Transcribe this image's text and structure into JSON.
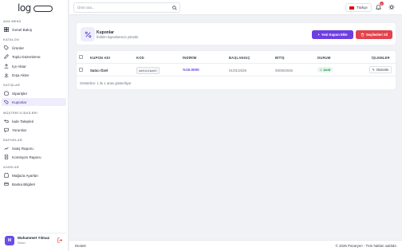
{
  "brand": {
    "logo_text": "log"
  },
  "sidebar": {
    "sections": [
      {
        "title": "ANA MENÜ",
        "items": [
          {
            "label": "Genel Bakış",
            "icon": "grid-icon"
          }
        ]
      },
      {
        "title": "KATALOG",
        "items": [
          {
            "label": "Ürünler",
            "icon": "tag-icon"
          },
          {
            "label": "Toplu Düzenleme",
            "icon": "edit-icon"
          },
          {
            "label": "İçe Aktar",
            "icon": "upload-icon"
          },
          {
            "label": "Dışa Aktar",
            "icon": "download-icon"
          }
        ]
      },
      {
        "title": "SATIŞLAR",
        "items": [
          {
            "label": "Siparişler",
            "icon": "box-icon"
          },
          {
            "label": "Kuponlar",
            "icon": "ticket-icon",
            "active": true
          }
        ]
      },
      {
        "title": "MÜŞTERİ İLİŞKİLERİ",
        "items": [
          {
            "label": "İade Talepleri",
            "icon": "return-icon"
          },
          {
            "label": "Yorumlar",
            "icon": "comment-icon"
          }
        ]
      },
      {
        "title": "RAPORLAR",
        "items": [
          {
            "label": "Satış Raporu",
            "icon": "trend-icon"
          },
          {
            "label": "Komisyon Raporu",
            "icon": "report-icon"
          }
        ]
      },
      {
        "title": "AYARLAR",
        "items": [
          {
            "label": "Mağaza Ayarları",
            "icon": "store-icon"
          },
          {
            "label": "Banka Bilgileri",
            "icon": "bank-icon"
          }
        ]
      }
    ],
    "user": {
      "initial": "M",
      "name": "Muhammet Yılmaz",
      "role": "Satıcı"
    }
  },
  "topbar": {
    "search_placeholder": "Ürün ara...",
    "language": "Türkçe",
    "notification_count": "0"
  },
  "header": {
    "title": "Kuponlar",
    "subtitle": "İndirim kuponlarınızı yönetin",
    "new_button": "Yeni Kupon Ekle",
    "delete_button": "Seçilenleri Sil"
  },
  "table": {
    "columns": [
      "KUPON ADI",
      "KOD",
      "İNDİRİM",
      "BAŞLANGIÇ",
      "BİTİŞ",
      "DURUM",
      "İŞLEMLER"
    ],
    "rows": [
      {
        "name": "Satıcı Özel",
        "code": "saticiozel",
        "discount": "%15.0000",
        "start": "01/01/2026",
        "end": "05/06/2026",
        "status": "Aktif",
        "action": "Düzenle"
      }
    ],
    "summary": "Gösterilen: 1 ile 1 arası gösteriliyor"
  },
  "footer": {
    "left": "Destek",
    "right": "© 2026 Pazaryeri - Tüm hakları saklıdır."
  },
  "colors": {
    "accent": "#6d3fe0",
    "danger": "#e2434c",
    "success": "#1e9a4b"
  }
}
